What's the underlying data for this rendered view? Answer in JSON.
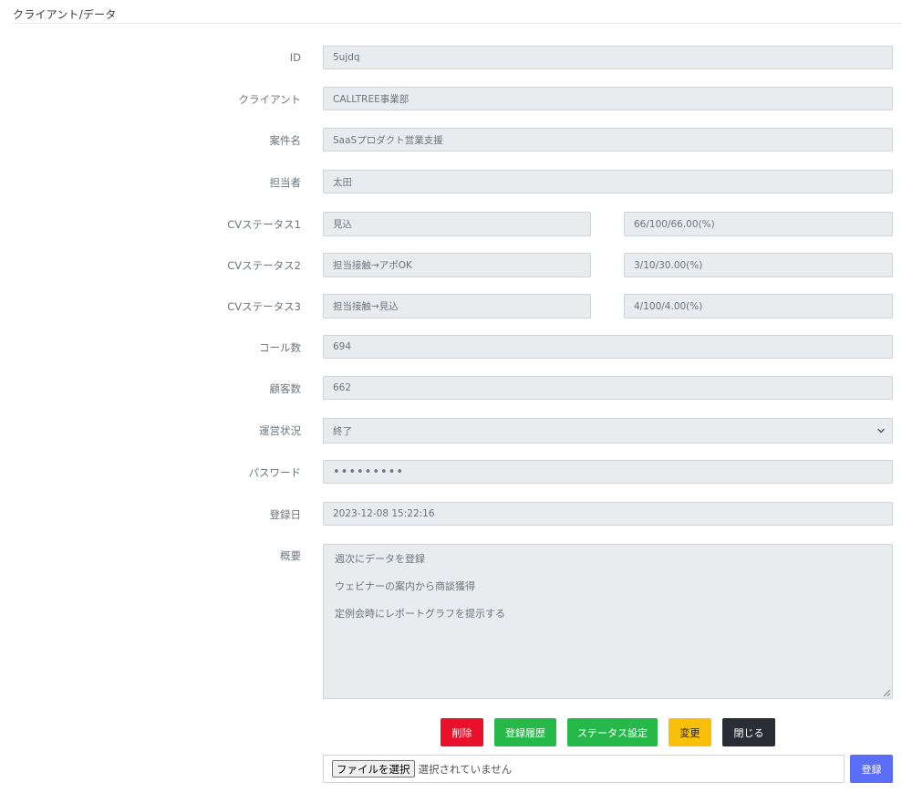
{
  "page": {
    "title": "クライアント/データ"
  },
  "form": {
    "id": {
      "label": "ID",
      "value": "5ujdq"
    },
    "client": {
      "label": "クライアント",
      "value": "CALLTREE事業部"
    },
    "project": {
      "label": "案件名",
      "value": "SaaSプロダクト営業支援"
    },
    "owner": {
      "label": "担当者",
      "value": "太田"
    },
    "cv1": {
      "label": "CVステータス1",
      "status": "見込",
      "rate": "66/100/66.00(%)"
    },
    "cv2": {
      "label": "CVステータス2",
      "status": "担当接触→アポOK",
      "rate": "3/10/30.00(%)"
    },
    "cv3": {
      "label": "CVステータス3",
      "status": "担当接触→見込",
      "rate": "4/100/4.00(%)"
    },
    "calls": {
      "label": "コール数",
      "value": "694"
    },
    "customers": {
      "label": "顧客数",
      "value": "662"
    },
    "operation": {
      "label": "運営状況",
      "value": "終了"
    },
    "password": {
      "label": "パスワード",
      "value": "•••••••••"
    },
    "registered": {
      "label": "登録日",
      "value": "2023-12-08 15:22:16"
    },
    "summary": {
      "label": "概要",
      "lines": [
        "週次にデータを登録",
        "ウェビナーの案内から商談獲得",
        "定例会時にレポートグラフを提示する"
      ]
    }
  },
  "buttons": {
    "delete": "削除",
    "history": "登録履歴",
    "status_settings": "ステータス設定",
    "change": "変更",
    "close": "閉じる",
    "register": "登録"
  },
  "file": {
    "choose": "ファイルを選択",
    "status": "選択されていません"
  },
  "colors": {
    "delete": "#e8102b",
    "success": "#26b94a",
    "warning": "#f8c00a",
    "dark": "#2a2d35",
    "primary": "#5a6ef7",
    "field_bg": "#e9ecef"
  }
}
